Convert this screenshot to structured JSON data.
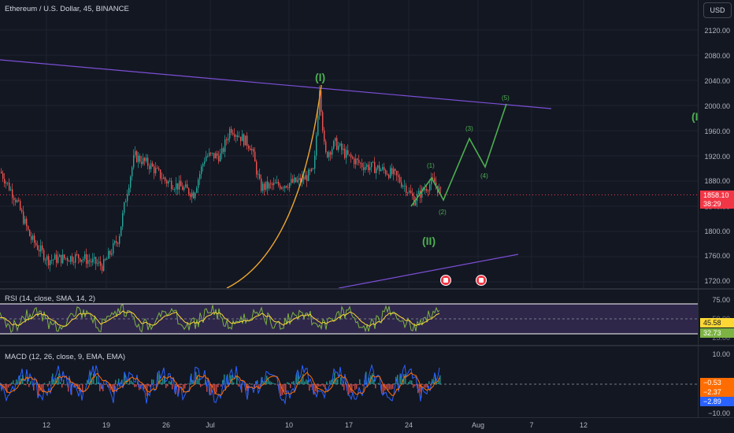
{
  "header": {
    "symbol_title": "Ethereum / U.S. Dollar, 45, BINANCE",
    "currency": "USD"
  },
  "price_axis": {
    "ticks": [
      "2120.00",
      "2080.00",
      "2040.00",
      "2000.00",
      "1960.00",
      "1920.00",
      "1880.00",
      "1800.00",
      "1760.00",
      "1720.00"
    ],
    "last_price": "1858.10",
    "countdown": "38:29",
    "partial_tick": "1840.00"
  },
  "rsi": {
    "title": "RSI (14, close, SMA, 14, 2)",
    "ticks": [
      "75.00",
      "50.00",
      "25.00"
    ],
    "value_badge": "45.58",
    "sma_badge": "32.73"
  },
  "macd": {
    "title": "MACD (12, 26, close, 9, EMA, EMA)",
    "ticks": [
      "10.00",
      "−10.00"
    ],
    "hist_badge": "−0.53",
    "signal_badge": "−2.37",
    "macd_badge": "−2.89"
  },
  "time_axis": {
    "labels": [
      "12",
      "19",
      "26",
      "Jul",
      "10",
      "17",
      "24",
      "Aug",
      "7",
      "12"
    ]
  },
  "annotations": {
    "wave_i_top": "(I)",
    "wave_ii": "(II)",
    "wave_right_edge": "(I",
    "sub_waves": [
      "(1)",
      "(2)",
      "(3)",
      "(4)",
      "(5)"
    ]
  },
  "colors": {
    "up": "#26a69a",
    "down": "#ef5350",
    "trendline": "#7b4fd6",
    "curve": "#f0a830",
    "projection": "#4caf50",
    "rsi_line": "#7cb342",
    "rsi_sma": "#fdd835",
    "rsi_band": "rgba(126,87,194,0.25)",
    "macd_line": "#2962ff",
    "signal_line": "#ff6d00",
    "price_badge": "#f23645"
  }
}
